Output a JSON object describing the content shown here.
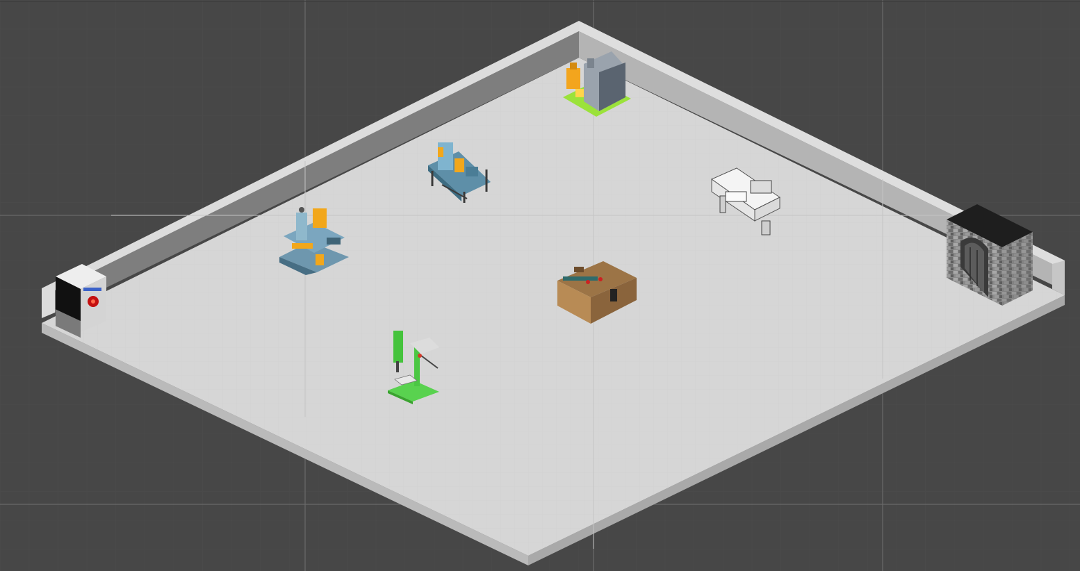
{
  "scene": {
    "view": "isometric",
    "background_color": "#474747",
    "grid_color": "#5a5a5a",
    "axis_color": "#6a6a6a",
    "floor_color": "#d6d6d6",
    "wall_colors": {
      "top": "#dcdcdc",
      "left_face": "#7d7d7d",
      "right_face": "#b2b2b2",
      "front_face": "#bdbdbd"
    },
    "objects": [
      {
        "id": "hal-terminal",
        "kind": "computer terminal",
        "icon": "terminal-icon",
        "accent": "#d21a1a"
      },
      {
        "id": "industrial-boiler",
        "kind": "boiler machine",
        "icon": "boiler-icon",
        "accent": "#f2a71b"
      },
      {
        "id": "press-machine",
        "kind": "press workbench",
        "icon": "press-icon",
        "accent": "#f2a71b"
      },
      {
        "id": "lathe-machine",
        "kind": "lathe",
        "icon": "lathe-icon",
        "accent": "#ffffff"
      },
      {
        "id": "welding-station",
        "kind": "welding station",
        "icon": "welder-icon",
        "accent": "#f2a71b"
      },
      {
        "id": "workbench",
        "kind": "wooden workbench",
        "icon": "workbench-icon",
        "accent": "#a07a4e"
      },
      {
        "id": "drill-press",
        "kind": "drill press",
        "icon": "drill-press-icon",
        "accent": "#4fd14a"
      },
      {
        "id": "stone-furnace",
        "kind": "stone furnace",
        "icon": "furnace-icon",
        "accent": "#2b2b2b"
      }
    ]
  }
}
